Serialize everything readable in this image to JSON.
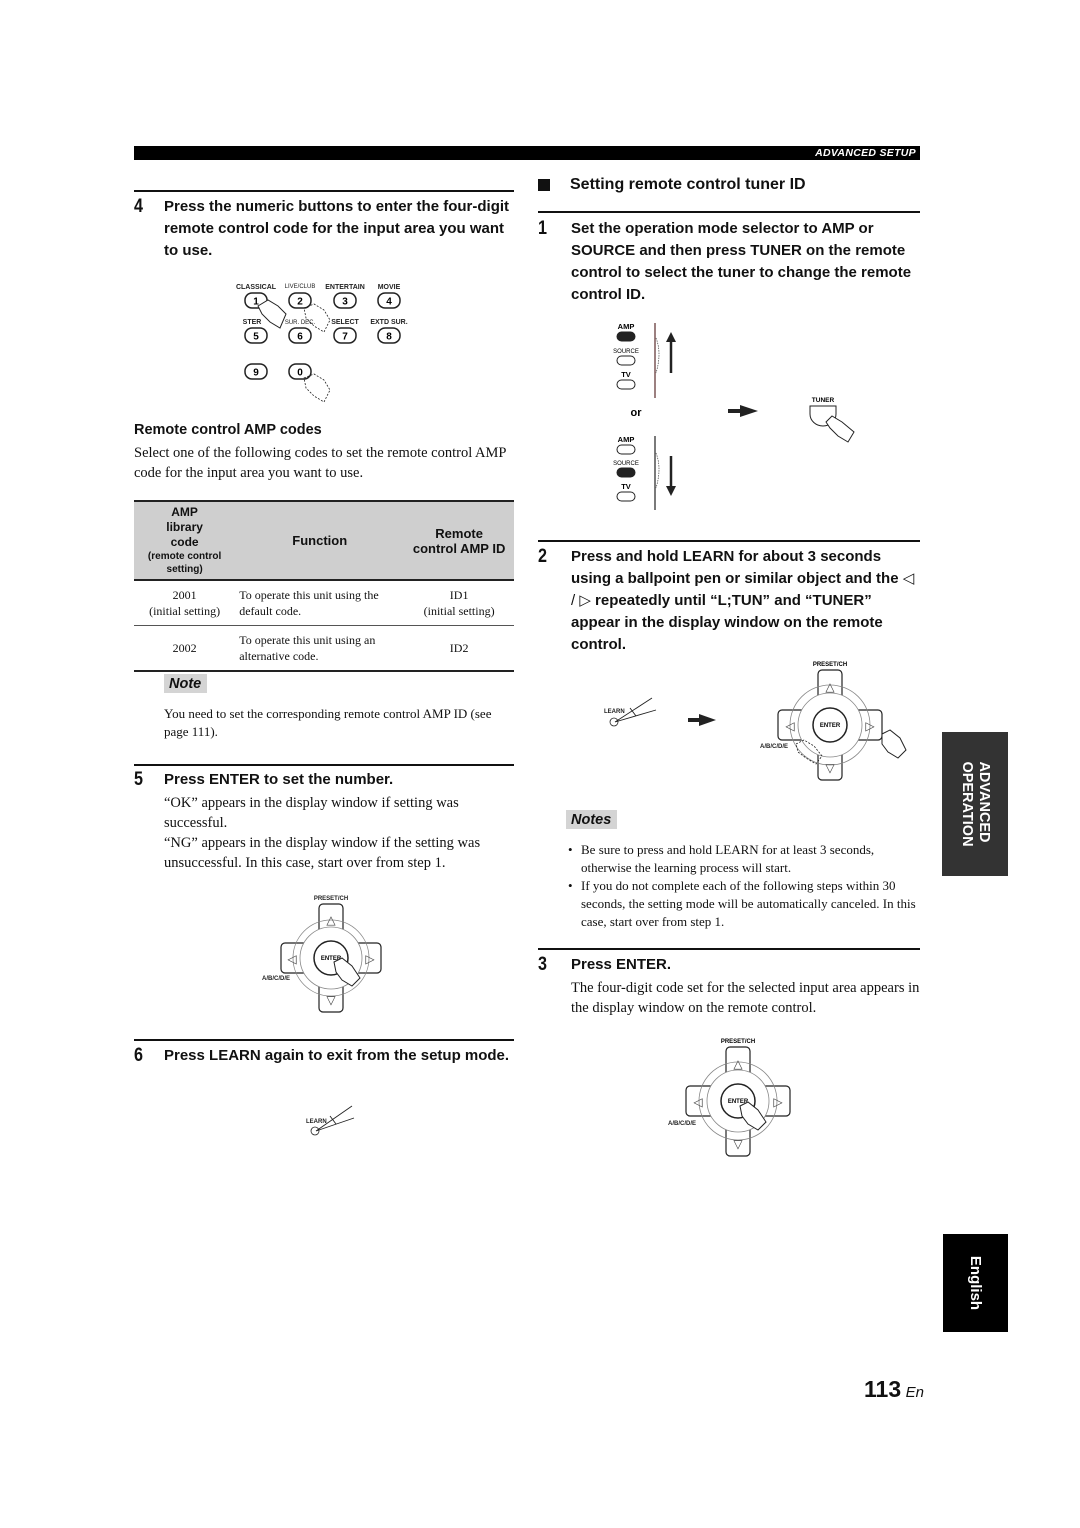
{
  "header": {
    "section_label": "ADVANCED SETUP"
  },
  "left": {
    "step4": {
      "number": "4",
      "text": "Press the numeric buttons to enter the four-digit remote control code for the input area you want to use.",
      "keypad": {
        "row1_labels": [
          "CLASSICAL",
          "LIVE/CLUB",
          "ENTERTAIN",
          "MOVIE"
        ],
        "row1_keys": [
          "1",
          "2",
          "3",
          "4"
        ],
        "row2_labels": [
          "STEREO",
          "SUR. DEC.",
          "SELECT",
          "EXTD SUR."
        ],
        "row2_keys": [
          "5",
          "6",
          "7",
          "8"
        ],
        "row3_keys": [
          "9",
          "0"
        ]
      }
    },
    "amp_codes": {
      "heading": "Remote control AMP codes",
      "intro": "Select one of the following codes to set the remote control AMP code for the input area you want to use.",
      "table": {
        "headers": {
          "col1_main": "AMP library code",
          "col1_sub": "(remote control setting)",
          "col2": "Function",
          "col3": "Remote control AMP ID"
        },
        "rows": [
          {
            "code": "2001",
            "code_note": "(initial setting)",
            "function": "To operate this unit using the default code.",
            "id": "ID1",
            "id_note": "(initial setting)"
          },
          {
            "code": "2002",
            "code_note": "",
            "function": "To operate this unit using an alternative code.",
            "id": "ID2",
            "id_note": ""
          }
        ]
      }
    },
    "note": {
      "badge": "Note",
      "text": "You need to set the corresponding remote control AMP ID (see page 111)."
    },
    "step5": {
      "number": "5",
      "text": "Press ENTER to set the number.",
      "para1": "“OK” appears in the display window if setting was successful.",
      "para2": "“NG” appears in the display window if the setting was unsuccessful. In this case, start over from step 1."
    },
    "step6": {
      "number": "6",
      "text": "Press LEARN again to exit from the setup mode."
    }
  },
  "right": {
    "section_title": "Setting remote control tuner ID",
    "step1": {
      "number": "1",
      "text": "Set the operation mode selector to AMP or SOURCE and then press TUNER on the remote control to select the tuner to change the remote control ID.",
      "selector_labels": [
        "AMP",
        "SOURCE",
        "TV"
      ],
      "or_label": "or",
      "tuner_label": "TUNER"
    },
    "step2": {
      "number": "2",
      "text_part1": "Press and hold LEARN for about 3 seconds using a ballpoint pen or similar object and the ",
      "arrows": "◁ / ▷",
      "text_part2": " repeatedly until “L;TUN” and “TUNER” appear in the display window on the remote control."
    },
    "notes": {
      "badge": "Notes",
      "items": [
        "Be sure to press and hold LEARN for at least 3 seconds, otherwise the learning process will start.",
        "If you do not complete each of the following steps within 30 seconds, the setting mode will be automatically canceled. In this case, start over from step 1."
      ]
    },
    "step3": {
      "number": "3",
      "text": "Press ENTER.",
      "para": "The four-digit code set for the selected input area appears in the display window on the remote control."
    }
  },
  "diagram_labels": {
    "preset_ch": "PRESET/CH",
    "enter": "ENTER",
    "abcde": "A/B/C/D/E",
    "learn": "LEARN"
  },
  "side_tabs": {
    "advanced_line1": "ADVANCED",
    "advanced_line2": "OPERATION",
    "language": "English"
  },
  "footer": {
    "page_number": "113",
    "page_suffix": "En"
  }
}
